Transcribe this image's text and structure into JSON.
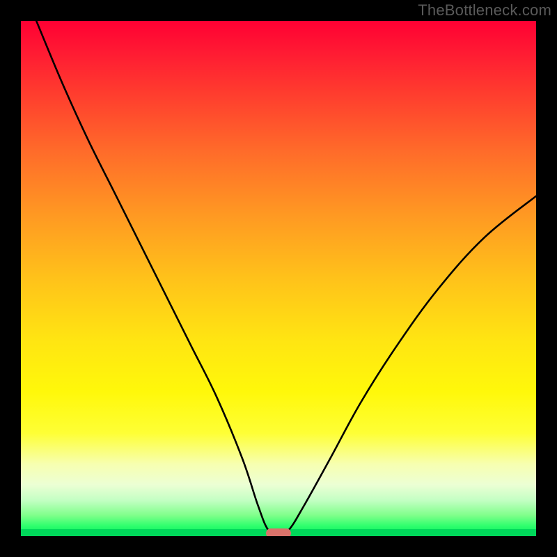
{
  "watermark": "TheBottleneck.com",
  "chart_data": {
    "type": "line",
    "title": "",
    "xlabel": "",
    "ylabel": "",
    "xlim": [
      0,
      100
    ],
    "ylim": [
      0,
      100
    ],
    "grid": false,
    "legend": false,
    "background_gradient": {
      "top": "#ff0033",
      "mid": "#fff80a",
      "bottom": "#00e85c"
    },
    "series": [
      {
        "name": "bottleneck-curve",
        "x": [
          3,
          8,
          13,
          18,
          23,
          28,
          33,
          38,
          43,
          46,
          48,
          50,
          52,
          55,
          60,
          66,
          73,
          81,
          90,
          100
        ],
        "y": [
          100,
          88,
          77,
          67,
          57,
          47,
          37,
          27,
          15,
          6,
          1.2,
          0.4,
          1.2,
          6,
          15,
          26,
          37,
          48,
          58,
          66
        ]
      }
    ],
    "marker": {
      "name": "optimal-point",
      "x": 50,
      "y": 0.5,
      "color": "#d9726a",
      "shape": "rounded-rect"
    }
  },
  "colors": {
    "frame": "#000000",
    "curve": "#000000",
    "marker": "#d9726a",
    "watermark": "#5a5a5a"
  }
}
